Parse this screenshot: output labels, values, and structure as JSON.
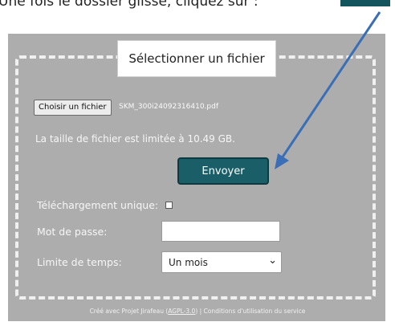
{
  "instruction": {
    "text": "Une fois le dossier glissé, cliquez sur : ",
    "swatch_color": "#14545c"
  },
  "form": {
    "title": "Sélectionner un fichier",
    "choose_file_label": "Choisir un fichier",
    "selected_file": "SKM_300i24092316410.pdf",
    "size_limit_text": "La taille de fichier est limitée à 10.49 GB.",
    "send_label": "Envoyer",
    "one_time_label": "Téléchargement unique:",
    "one_time_checked": false,
    "password_label": "Mot de passe:",
    "password_value": "",
    "time_limit_label": "Limite de temps:",
    "time_limit_value": "Un mois"
  },
  "footer": {
    "prefix": "Créé avec Projet Jirafeau (",
    "license_link": "AGPL-3.0",
    "middle": ") | ",
    "terms_link": "Conditions d'utilisation du service"
  },
  "annotation": {
    "arrow_color": "#3a6fb8",
    "target": "send-button"
  },
  "colors": {
    "panel_bg": "#adadad",
    "button_teal": "#1a5f68"
  }
}
